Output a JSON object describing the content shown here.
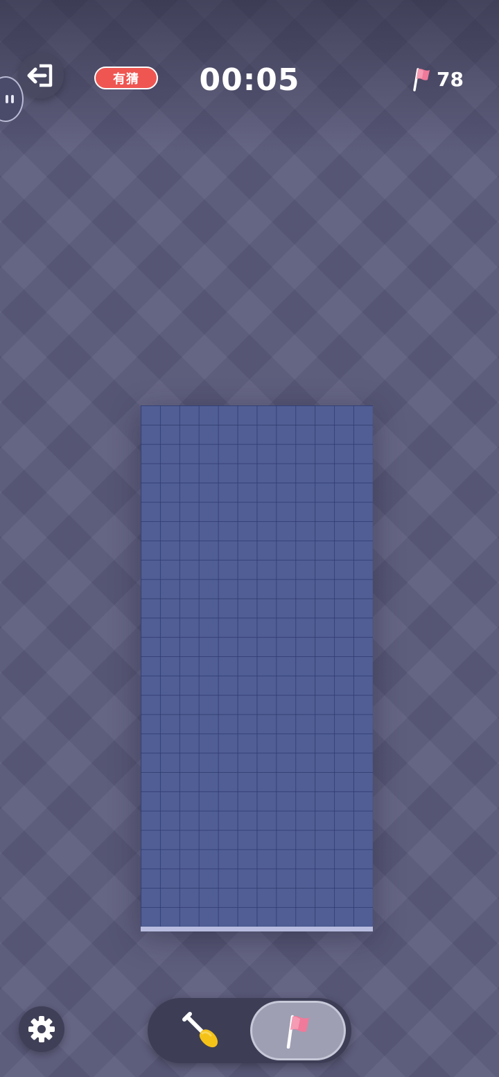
{
  "header": {
    "badge_label": "有猜",
    "timer": "00:05",
    "flags_remaining": "78"
  },
  "board": {
    "columns": 12,
    "rows": 27,
    "state": "all-covered"
  },
  "controls": {
    "mode_options": [
      "dig",
      "flag"
    ],
    "selected_mode": "flag"
  },
  "icons": {
    "exit": "exit-icon",
    "settings": "gear-icon",
    "dig": "shovel-icon",
    "flag": "flag-icon",
    "chat": "chat-bubble-icon"
  },
  "colors": {
    "background": "#5b5b7c",
    "tile": "#505e95",
    "badge": "#ef5652",
    "flag": "#f07a9a",
    "shovel_blade": "#f5c218"
  }
}
